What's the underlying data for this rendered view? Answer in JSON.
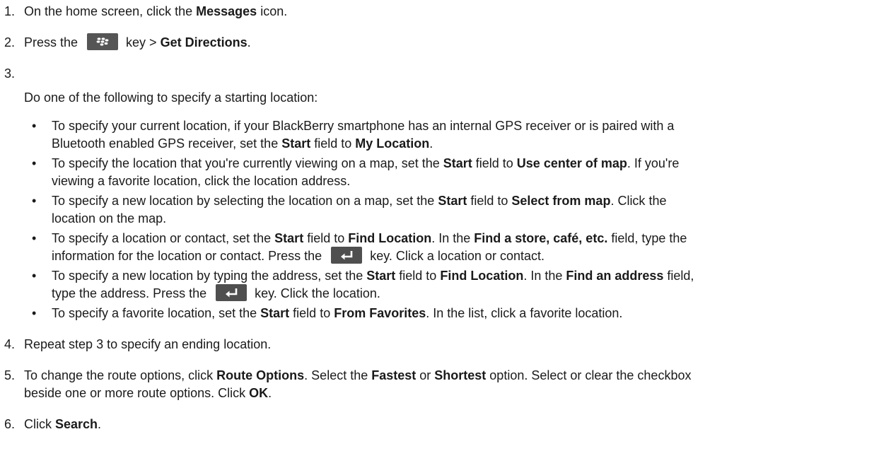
{
  "steps": [
    {
      "number": "1.",
      "pre": "On the home screen, click the ",
      "bold1": "Messages",
      "post": " icon."
    },
    {
      "number": "2.",
      "pre": "Press the ",
      "after_key": " key > ",
      "bold1": "Get Directions",
      "post": "."
    },
    {
      "number": "3.",
      "intro": "Do one of the following to specify a starting location:"
    },
    {
      "number": "4.",
      "text": "Repeat step 3 to specify an ending location."
    },
    {
      "number": "5.",
      "pre": "To change the route options, click ",
      "bold1": "Route Options",
      "mid1": ". Select the ",
      "bold2": "Fastest",
      "mid2": " or ",
      "bold3": "Shortest",
      "mid3": " option. Select or clear the checkbox",
      "line2_pre": "beside one or more route options. Click ",
      "bold4": "OK",
      "post": "."
    },
    {
      "number": "6.",
      "pre": "Click ",
      "bold1": "Search",
      "post": "."
    }
  ],
  "bullets": [
    {
      "bullet": "•",
      "l1_pre": "To specify your current location, if your BlackBerry smartphone has an internal GPS receiver or is paired with a",
      "l2_pre": "Bluetooth enabled GPS receiver, set the ",
      "b1": "Start",
      "l2_mid": " field to ",
      "b2": "My Location",
      "l2_post": "."
    },
    {
      "bullet": "•",
      "l1_pre": "To specify the location that you're currently viewing on a map, set the ",
      "b1": "Start",
      "l1_mid": " field to ",
      "b2": "Use center of map",
      "l1_post": ". If you're",
      "l2_pre": "viewing a favorite location, click the location address."
    },
    {
      "bullet": "•",
      "l1_pre": "To specify a new location by selecting the location on a map, set the ",
      "b1": "Start",
      "l1_mid": " field to ",
      "b2": "Select from map",
      "l1_post": ". Click the",
      "l2_pre": "location on the map."
    },
    {
      "bullet": "•",
      "l1_pre": "To specify a location or contact, set the ",
      "b1": "Start",
      "l1_mid": " field to ",
      "b2": "Find Location",
      "l1_mid2": ". In the ",
      "b3": "Find a store, café, etc.",
      "l1_post": " field, type the",
      "l2_pre": "information for the location or contact. Press the ",
      "l2_post": " key. Click a location or contact."
    },
    {
      "bullet": "•",
      "l1_pre": "To specify a new location by typing the address, set the ",
      "b1": "Start",
      "l1_mid": " field to ",
      "b2": "Find Location",
      "l1_mid2": ". In the ",
      "b3": "Find an address",
      "l1_post": " field,",
      "l2_pre": "type the address. Press the ",
      "l2_post": " key. Click the location."
    },
    {
      "bullet": "•",
      "l1_pre": "To specify a favorite location, set the ",
      "b1": "Start",
      "l1_mid": " field to ",
      "b2": "From Favorites",
      "l1_post": ". In the list, click a favorite location."
    }
  ],
  "icons": {
    "menu_key": "blackberry-menu-key-icon",
    "enter_key": "enter-key-icon"
  },
  "colors": {
    "text": "#1a1a1a",
    "key_background": "#555555",
    "key_glyph": "#ffffff"
  }
}
